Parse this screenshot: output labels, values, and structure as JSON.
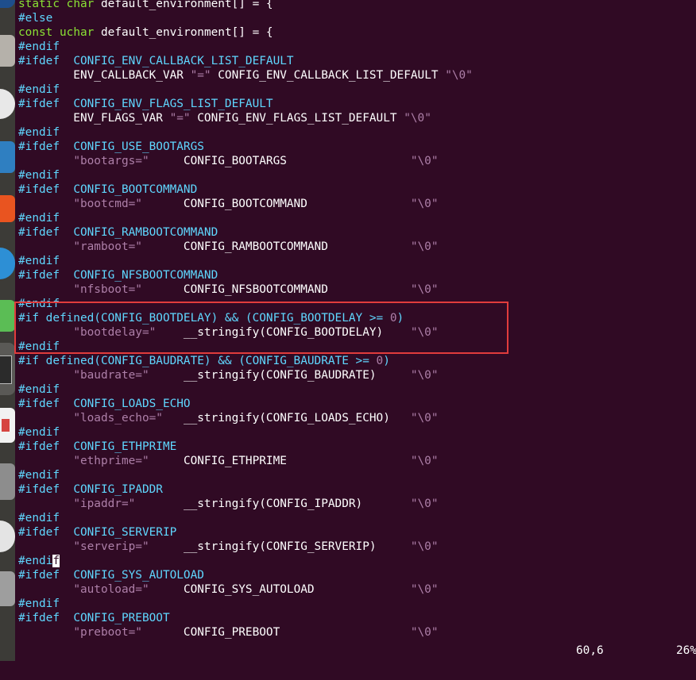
{
  "editor": {
    "lines": [
      [
        {
          "t": "static",
          "c": "kw"
        },
        {
          "t": " "
        },
        {
          "t": "char",
          "c": "kw"
        },
        {
          "t": " default_environment[] = {"
        }
      ],
      [
        {
          "t": "#else",
          "c": "pp"
        }
      ],
      [
        {
          "t": "const",
          "c": "kw"
        },
        {
          "t": " "
        },
        {
          "t": "uchar",
          "c": "kw"
        },
        {
          "t": " default_environment[] = {"
        }
      ],
      [
        {
          "t": "#endif",
          "c": "pp"
        }
      ],
      [
        {
          "t": "#ifdef",
          "c": "pp"
        },
        {
          "t": "  "
        },
        {
          "t": "CONFIG_ENV_CALLBACK_LIST_DEFAULT",
          "c": "pp"
        }
      ],
      [
        {
          "t": "        ENV_CALLBACK_VAR "
        },
        {
          "t": "\"=\"",
          "c": "str"
        },
        {
          "t": " CONFIG_ENV_CALLBACK_LIST_DEFAULT "
        },
        {
          "t": "\"\\0\"",
          "c": "str"
        }
      ],
      [
        {
          "t": "#endif",
          "c": "pp"
        }
      ],
      [
        {
          "t": "#ifdef",
          "c": "pp"
        },
        {
          "t": "  "
        },
        {
          "t": "CONFIG_ENV_FLAGS_LIST_DEFAULT",
          "c": "pp"
        }
      ],
      [
        {
          "t": "        ENV_FLAGS_VAR "
        },
        {
          "t": "\"=\"",
          "c": "str"
        },
        {
          "t": " CONFIG_ENV_FLAGS_LIST_DEFAULT "
        },
        {
          "t": "\"\\0\"",
          "c": "str"
        }
      ],
      [
        {
          "t": "#endif",
          "c": "pp"
        }
      ],
      [
        {
          "t": "#ifdef",
          "c": "pp"
        },
        {
          "t": "  "
        },
        {
          "t": "CONFIG_USE_BOOTARGS",
          "c": "pp"
        }
      ],
      [
        {
          "t": "        "
        },
        {
          "t": "\"bootargs=\"",
          "c": "str"
        },
        {
          "t": "     CONFIG_BOOTARGS                  "
        },
        {
          "t": "\"\\0\"",
          "c": "str"
        }
      ],
      [
        {
          "t": "#endif",
          "c": "pp"
        }
      ],
      [
        {
          "t": "#ifdef",
          "c": "pp"
        },
        {
          "t": "  "
        },
        {
          "t": "CONFIG_BOOTCOMMAND",
          "c": "pp"
        }
      ],
      [
        {
          "t": "        "
        },
        {
          "t": "\"bootcmd=\"",
          "c": "str"
        },
        {
          "t": "      CONFIG_BOOTCOMMAND               "
        },
        {
          "t": "\"\\0\"",
          "c": "str"
        }
      ],
      [
        {
          "t": "#endif",
          "c": "pp"
        }
      ],
      [
        {
          "t": "#ifdef",
          "c": "pp"
        },
        {
          "t": "  "
        },
        {
          "t": "CONFIG_RAMBOOTCOMMAND",
          "c": "pp"
        }
      ],
      [
        {
          "t": "        "
        },
        {
          "t": "\"ramboot=\"",
          "c": "str"
        },
        {
          "t": "      CONFIG_RAMBOOTCOMMAND            "
        },
        {
          "t": "\"\\0\"",
          "c": "str"
        }
      ],
      [
        {
          "t": "#endif",
          "c": "pp"
        }
      ],
      [
        {
          "t": "#ifdef",
          "c": "pp"
        },
        {
          "t": "  "
        },
        {
          "t": "CONFIG_NFSBOOTCOMMAND",
          "c": "pp"
        }
      ],
      [
        {
          "t": "        "
        },
        {
          "t": "\"nfsboot=\"",
          "c": "str"
        },
        {
          "t": "      CONFIG_NFSBOOTCOMMAND            "
        },
        {
          "t": "\"\\0\"",
          "c": "str"
        }
      ],
      [
        {
          "t": "#endif",
          "c": "pp"
        }
      ],
      [
        {
          "t": "#if defined(CONFIG_BOOTDELAY) && (CONFIG_BOOTDELAY >= ",
          "c": "pp"
        },
        {
          "t": "0",
          "c": "num"
        },
        {
          "t": ")",
          "c": "pp"
        }
      ],
      [
        {
          "t": "        "
        },
        {
          "t": "\"bootdelay=\"",
          "c": "str"
        },
        {
          "t": "    __stringify(CONFIG_BOOTDELAY)    "
        },
        {
          "t": "\"\\0\"",
          "c": "str"
        }
      ],
      [
        {
          "t": "#endif",
          "c": "pp"
        }
      ],
      [
        {
          "t": "#if defined(CONFIG_BAUDRATE) && (CONFIG_BAUDRATE >= ",
          "c": "pp"
        },
        {
          "t": "0",
          "c": "num"
        },
        {
          "t": ")",
          "c": "pp"
        }
      ],
      [
        {
          "t": "        "
        },
        {
          "t": "\"baudrate=\"",
          "c": "str"
        },
        {
          "t": "     __stringify(CONFIG_BAUDRATE)     "
        },
        {
          "t": "\"\\0\"",
          "c": "str"
        }
      ],
      [
        {
          "t": "#endif",
          "c": "pp"
        }
      ],
      [
        {
          "t": "#ifdef",
          "c": "pp"
        },
        {
          "t": "  "
        },
        {
          "t": "CONFIG_LOADS_ECHO",
          "c": "pp"
        }
      ],
      [
        {
          "t": "        "
        },
        {
          "t": "\"loads_echo=\"",
          "c": "str"
        },
        {
          "t": "   __stringify(CONFIG_LOADS_ECHO)   "
        },
        {
          "t": "\"\\0\"",
          "c": "str"
        }
      ],
      [
        {
          "t": "#endif",
          "c": "pp"
        }
      ],
      [
        {
          "t": "#ifdef",
          "c": "pp"
        },
        {
          "t": "  "
        },
        {
          "t": "CONFIG_ETHPRIME",
          "c": "pp"
        }
      ],
      [
        {
          "t": "        "
        },
        {
          "t": "\"ethprime=\"",
          "c": "str"
        },
        {
          "t": "     CONFIG_ETHPRIME                  "
        },
        {
          "t": "\"\\0\"",
          "c": "str"
        }
      ],
      [
        {
          "t": "#endif",
          "c": "pp"
        }
      ],
      [
        {
          "t": "#ifdef",
          "c": "pp"
        },
        {
          "t": "  "
        },
        {
          "t": "CONFIG_IPADDR",
          "c": "pp"
        }
      ],
      [
        {
          "t": "        "
        },
        {
          "t": "\"ipaddr=\"",
          "c": "str"
        },
        {
          "t": "       __stringify(CONFIG_IPADDR)       "
        },
        {
          "t": "\"\\0\"",
          "c": "str"
        }
      ],
      [
        {
          "t": "#endif",
          "c": "pp"
        }
      ],
      [
        {
          "t": "#ifdef",
          "c": "pp"
        },
        {
          "t": "  "
        },
        {
          "t": "CONFIG_SERVERIP",
          "c": "pp"
        }
      ],
      [
        {
          "t": "        "
        },
        {
          "t": "\"serverip=\"",
          "c": "str"
        },
        {
          "t": "     __stringify(CONFIG_SERVERIP)     "
        },
        {
          "t": "\"\\0\"",
          "c": "str"
        }
      ],
      [
        {
          "t": "#endi",
          "c": "pp"
        },
        {
          "t": "f",
          "c": "cursor"
        }
      ],
      [
        {
          "t": "#ifdef",
          "c": "pp"
        },
        {
          "t": "  "
        },
        {
          "t": "CONFIG_SYS_AUTOLOAD",
          "c": "pp"
        }
      ],
      [
        {
          "t": "        "
        },
        {
          "t": "\"autoload=\"",
          "c": "str"
        },
        {
          "t": "     CONFIG_SYS_AUTOLOAD              "
        },
        {
          "t": "\"\\0\"",
          "c": "str"
        }
      ],
      [
        {
          "t": "#endif",
          "c": "pp"
        }
      ],
      [
        {
          "t": "#ifdef",
          "c": "pp"
        },
        {
          "t": "  "
        },
        {
          "t": "CONFIG_PREBOOT",
          "c": "pp"
        }
      ],
      [
        {
          "t": "        "
        },
        {
          "t": "\"preboot=\"",
          "c": "str"
        },
        {
          "t": "      CONFIG_PREBOOT                   "
        },
        {
          "t": "\"\\0\"",
          "c": "str"
        }
      ]
    ]
  },
  "status": {
    "cursor_position": "60,6",
    "scroll_percent": "26%"
  },
  "dock": {
    "icons": [
      {
        "name": "terminal-icon",
        "color": "#2c2c2c"
      },
      {
        "name": "files-icon",
        "color": "#b0b0b0"
      },
      {
        "name": "chrome-icon",
        "color": "#dcdcdc"
      },
      {
        "name": "editor-icon",
        "color": "#3a87c4"
      },
      {
        "name": "software-icon",
        "color": "#e95420"
      },
      {
        "name": "browser-icon",
        "color": "#2d8fd5"
      },
      {
        "name": "messaging-icon",
        "color": "#5bbd55"
      },
      {
        "name": "active-app-icon",
        "color": "#5a5a5a"
      },
      {
        "name": "calendar-icon",
        "color": "#f0f0f0"
      },
      {
        "name": "settings-icon",
        "color": "#8a8a8a"
      },
      {
        "name": "disk-icon",
        "color": "#e0e0e0"
      },
      {
        "name": "trash-icon",
        "color": "#9a9a9a"
      }
    ]
  }
}
